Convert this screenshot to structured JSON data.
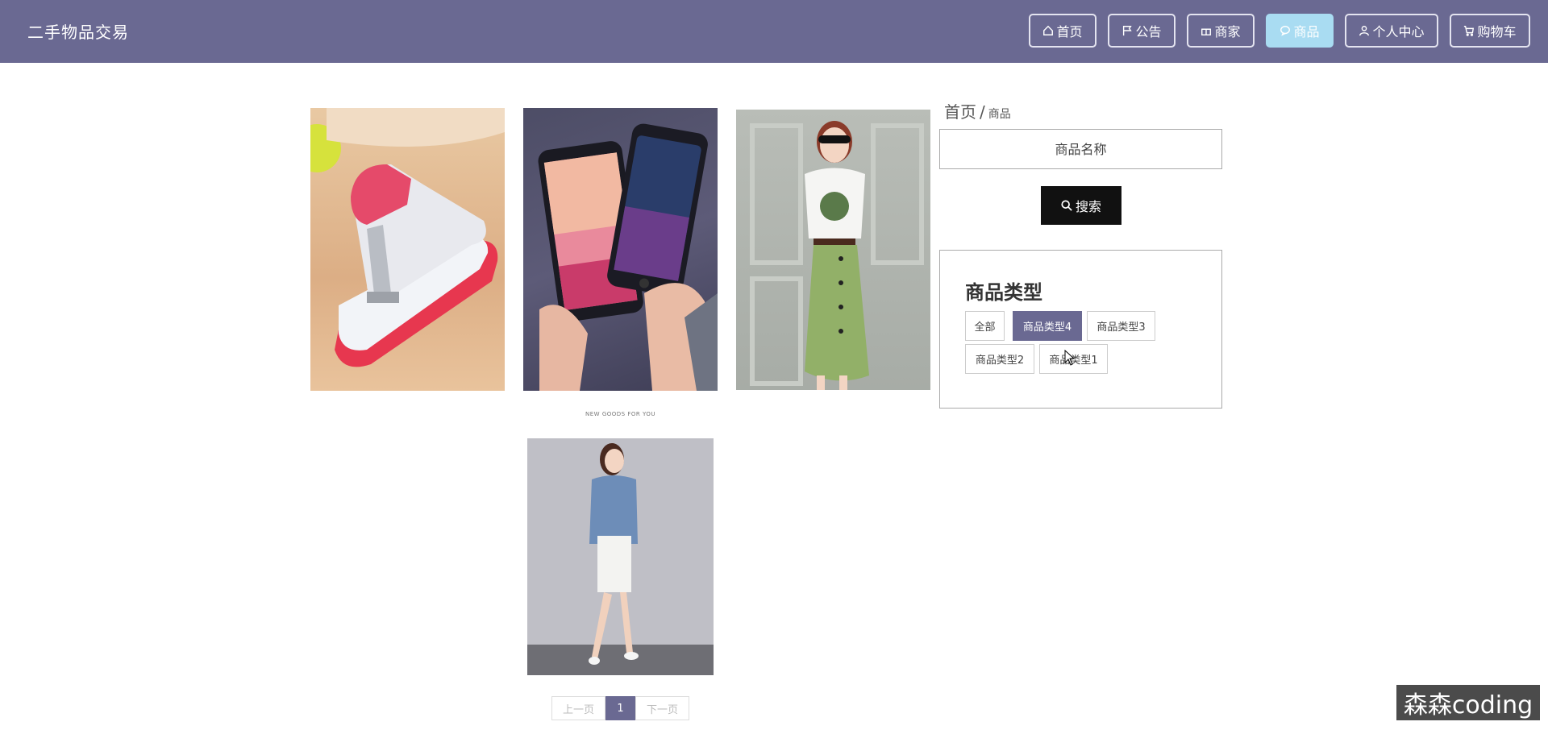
{
  "header": {
    "site_title": "二手物品交易",
    "nav": [
      {
        "label": "首页",
        "icon": "home-icon",
        "active": false
      },
      {
        "label": "公告",
        "icon": "flag-icon",
        "active": false
      },
      {
        "label": "商家",
        "icon": "gift-icon",
        "active": false
      },
      {
        "label": "商品",
        "icon": "chat-icon",
        "active": true
      },
      {
        "label": "个人中心",
        "icon": "user-icon",
        "active": false
      },
      {
        "label": "购物车",
        "icon": "cart-icon",
        "active": false
      }
    ]
  },
  "products": [
    {
      "image": "stapler-photo"
    },
    {
      "image": "smartphones-photo"
    },
    {
      "image": "woman-green-skirt-photo"
    },
    {
      "image": "woman-denim-top-photo",
      "caption_line1": "NEW GOODS FOR YOU"
    }
  ],
  "sidebar": {
    "breadcrumb_home": "首页",
    "breadcrumb_sep": "/",
    "breadcrumb_current": "商品",
    "search_placeholder": "商品名称",
    "search_label": "搜索",
    "type_title": "商品类型",
    "types": [
      {
        "label": "全部",
        "active": false
      },
      {
        "label": "商品类型4",
        "active": true
      },
      {
        "label": "商品类型3",
        "active": false
      },
      {
        "label": "商品类型2",
        "active": false
      },
      {
        "label": "商品类型1",
        "active": false
      }
    ]
  },
  "pagination": {
    "prev": "上一页",
    "current": "1",
    "next": "下一页"
  },
  "watermark": "森森coding",
  "colors": {
    "header": "#6a6992",
    "active_nav": "#a9dcf2",
    "accent": "#6a6992"
  }
}
